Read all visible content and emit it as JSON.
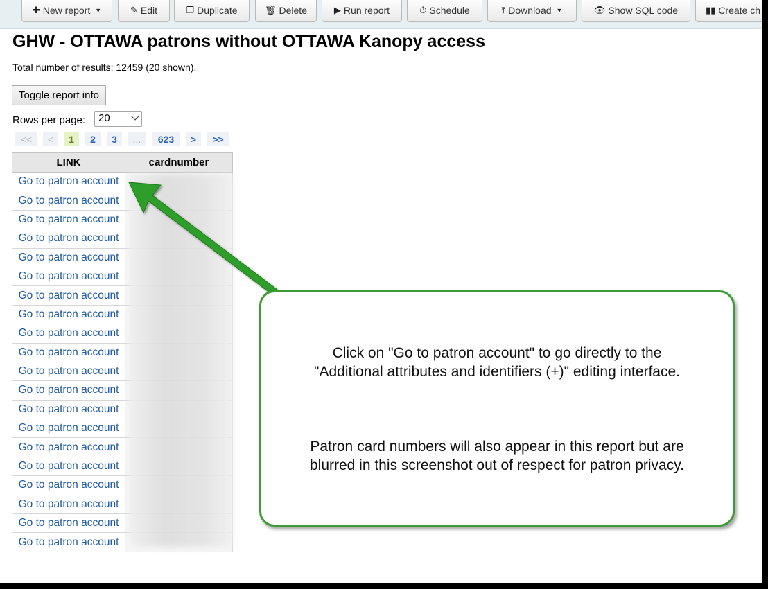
{
  "toolbar": {
    "new_report": "New report",
    "edit": "Edit",
    "duplicate": "Duplicate",
    "delete": "Delete",
    "run_report": "Run report",
    "schedule": "Schedule",
    "download": "Download",
    "show_sql": "Show SQL code",
    "create_chart": "Create ch"
  },
  "title": "GHW - OTTAWA patrons without OTTAWA Kanopy access",
  "total_text": "Total number of results: 12459 (20 shown).",
  "toggle_label": "Toggle report info",
  "rows_per_page": {
    "label": "Rows per page:",
    "value": "20"
  },
  "pager": {
    "first": "<<",
    "prev": "<",
    "p1": "1",
    "p2": "2",
    "p3": "3",
    "ellipsis": "...",
    "last_page": "623",
    "next": ">",
    "last": ">>"
  },
  "table": {
    "headers": [
      "LINK",
      "cardnumber"
    ],
    "link_text": "Go to patron account",
    "rows": [
      "Go to patron account",
      "Go to patron account",
      "Go to patron account",
      "Go to patron account",
      "Go to patron account",
      "Go to patron account",
      "Go to patron account",
      "Go to patron account",
      "Go to patron account",
      "Go to patron account",
      "Go to patron account",
      "Go to patron account",
      "Go to patron account",
      "Go to patron account",
      "Go to patron account",
      "Go to patron account",
      "Go to patron account",
      "Go to patron account",
      "Go to patron account",
      "Go to patron account"
    ]
  },
  "callout": {
    "line1": "Click on \"Go to patron account\" to go directly to the",
    "line2": "\"Additional attributes and identifiers (+)\" editing interface.",
    "line3": "Patron card numbers will also appear in this report but are",
    "line4": "blurred in this screenshot out of respect for patron privacy."
  },
  "colors": {
    "callout_border": "#3e9a35",
    "link": "#1f5aa0",
    "arrow": "#2f9e2b"
  }
}
